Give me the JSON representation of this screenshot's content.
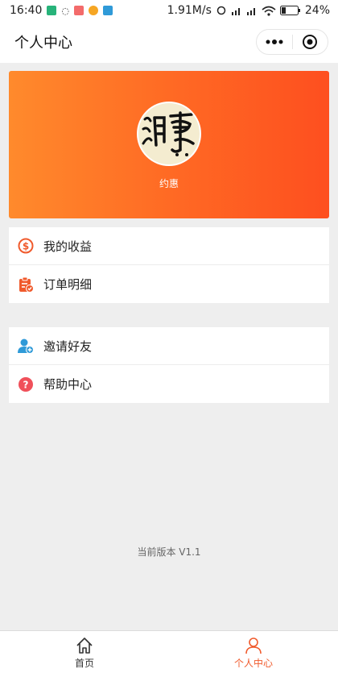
{
  "status_bar": {
    "time": "16:40",
    "speed": "1.91M/s",
    "battery": "24%"
  },
  "navbar": {
    "title": "个人中心"
  },
  "profile": {
    "username": "约惠"
  },
  "menu_group1": [
    {
      "label": "我的收益",
      "icon": "dollar-circle-icon"
    },
    {
      "label": "订单明细",
      "icon": "clipboard-check-icon"
    }
  ],
  "menu_group2": [
    {
      "label": "邀请好友",
      "icon": "add-user-icon"
    },
    {
      "label": "帮助中心",
      "icon": "question-circle-icon"
    }
  ],
  "footer": {
    "version": "当前版本 V1.1"
  },
  "tabbar": [
    {
      "label": "首页",
      "icon": "home-icon",
      "active": false
    },
    {
      "label": "个人中心",
      "icon": "person-icon",
      "active": true
    }
  ],
  "colors": {
    "accent": "#f05a2c",
    "banner_start": "#ff8a2c",
    "banner_end": "#fe4f1f",
    "icon_blue": "#2f9ad8",
    "icon_red": "#f0505a"
  }
}
